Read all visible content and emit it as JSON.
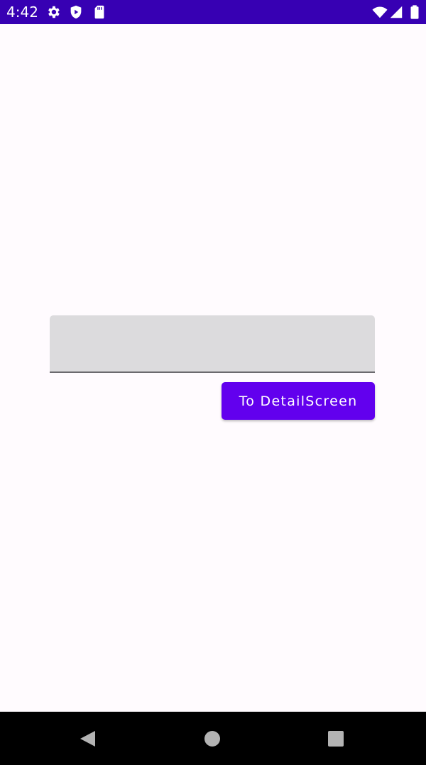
{
  "status_bar": {
    "time": "4:42",
    "color": "#3700b3",
    "icons_left": [
      "gear-icon",
      "shield-play-icon",
      "sd-card-icon"
    ],
    "icons_right": [
      "wifi-icon",
      "cell-signal-icon",
      "battery-icon"
    ]
  },
  "screen": {
    "background": "#fffbfe",
    "text_field": {
      "value": "",
      "placeholder": ""
    },
    "button": {
      "label": "To DetailScreen",
      "color": "#6200ee"
    }
  },
  "nav_bar": {
    "items": [
      "back-icon",
      "home-icon",
      "recents-icon"
    ]
  }
}
